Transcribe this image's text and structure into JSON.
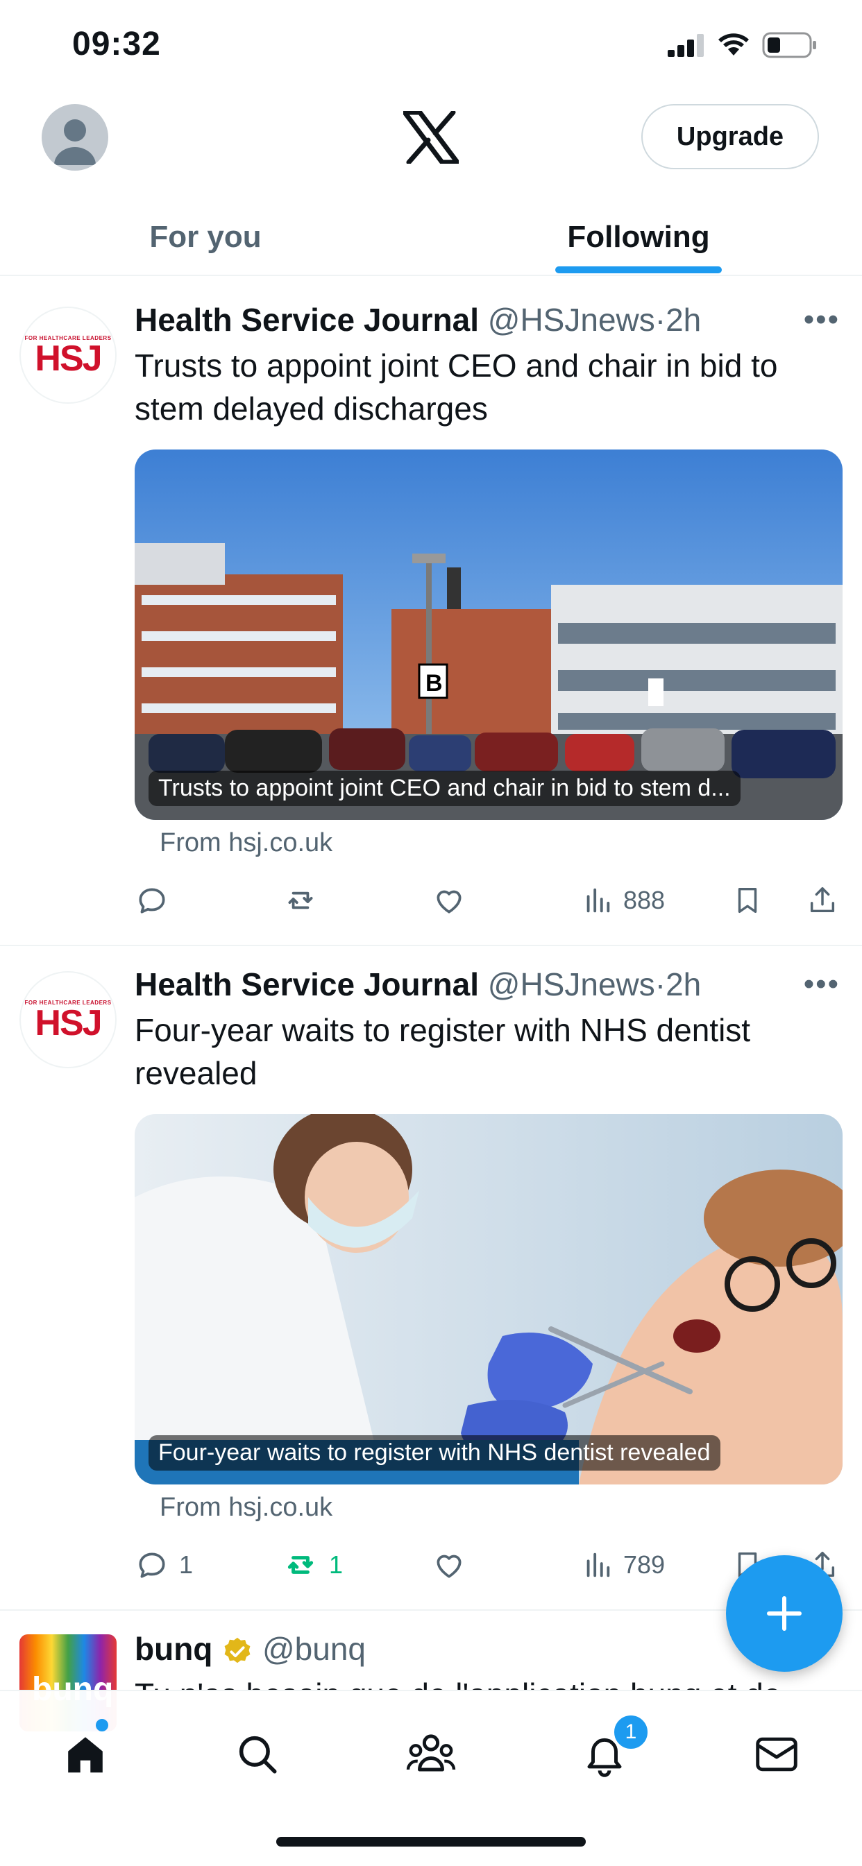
{
  "status_bar": {
    "time": "09:32"
  },
  "header": {
    "upgrade_label": "Upgrade"
  },
  "tabs": [
    {
      "label": "For you"
    },
    {
      "label": "Following"
    }
  ],
  "posts": [
    {
      "author": "Health Service Journal",
      "handle": "@HSJnews",
      "separator": "·",
      "time": "2h",
      "avatar_text": "HSJ",
      "avatar_small_text": "FOR HEALTHCARE LEADERS",
      "text": "Trusts to appoint joint CEO and chair in bid to stem delayed discharges",
      "media_caption": "Trusts to appoint joint CEO and chair in bid to stem d...",
      "source": "From hsj.co.uk",
      "replies": "",
      "reposts": "",
      "views": "888"
    },
    {
      "author": "Health Service Journal",
      "handle": "@HSJnews",
      "separator": "·",
      "time": "2h",
      "avatar_text": "HSJ",
      "avatar_small_text": "FOR HEALTHCARE LEADERS",
      "text": "Four-year waits to register with NHS dentist revealed",
      "media_caption": "Four-year waits to register with NHS dentist revealed",
      "source": "From hsj.co.uk",
      "replies": "1",
      "reposts": "1",
      "views": "789"
    },
    {
      "author": "bunq",
      "handle": "@bunq",
      "avatar_text": "bunq",
      "text": "Tu n'as besoin que de l'application bunq et de"
    }
  ],
  "bottom_nav": {
    "notifications_badge": "1"
  },
  "colors": {
    "accent": "#1d9bf0",
    "repost_active": "#00ba7c",
    "muted": "#536471"
  }
}
